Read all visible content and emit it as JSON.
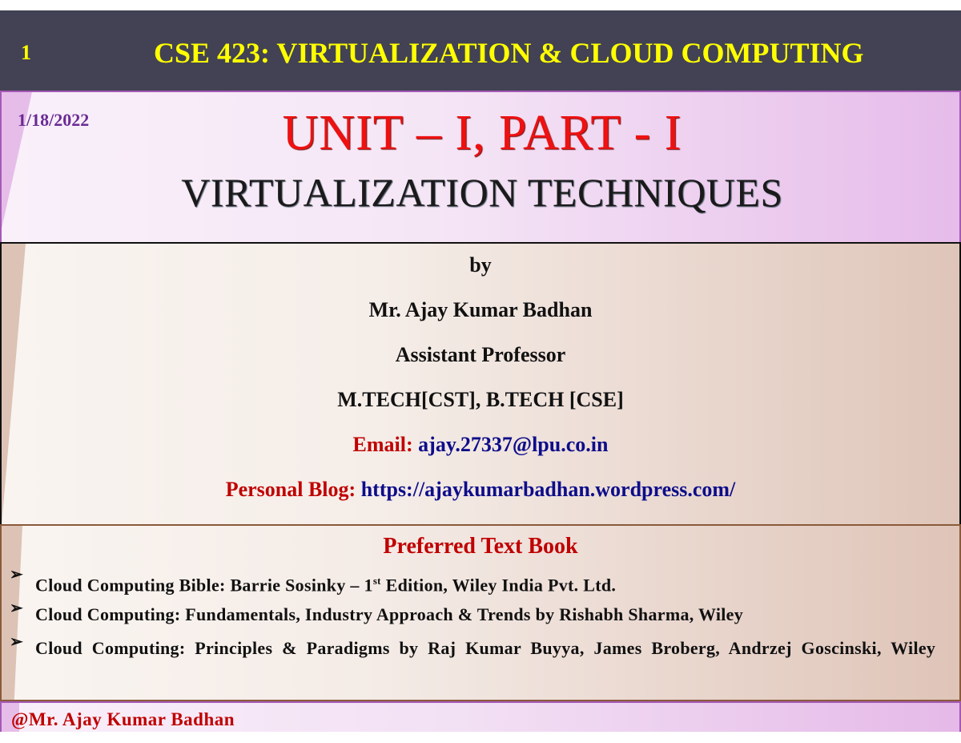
{
  "header": {
    "slide_number": "1",
    "course_title": "CSE 423: VIRTUALIZATION & CLOUD COMPUTING"
  },
  "title_panel": {
    "date": "1/18/2022",
    "unit_title": "UNIT – I, PART - I",
    "topic_title": "VIRTUALIZATION TECHNIQUES"
  },
  "author": {
    "by": "by",
    "name": "Mr. Ajay Kumar Badhan",
    "designation": "Assistant Professor",
    "qualifications": "M.TECH[CST], B.TECH [CSE]",
    "email_label": "Email:",
    "email": "ajay.27337@lpu.co.in",
    "blog_label": "Personal Blog:",
    "blog_url": "https://ajaykumarbadhan.wordpress.com/"
  },
  "textbooks": {
    "heading": "Preferred Text Book",
    "bullet_icon": "➢",
    "items": [
      {
        "before_sup": "Cloud Computing Bible: Barrie Sosinky – 1",
        "sup": "st",
        "after_sup": " Edition, Wiley India Pvt. Ltd."
      },
      {
        "text": "Cloud Computing: Fundamentals, Industry Approach & Trends by Rishabh Sharma, Wiley"
      },
      {
        "text": "Cloud Computing: Principles & Paradigms by Raj Kumar Buyya, James Broberg, Andrzej Goscinski, Wiley"
      }
    ]
  },
  "footer": {
    "text": "@Mr. Ajay Kumar Badhan"
  },
  "colors": {
    "header_bg": "#424254",
    "header_text": "#ffff00",
    "unit_title": "#ee1111",
    "label_red": "#c00000",
    "link_blue": "#0d0d8a",
    "date_purple": "#6a2a94"
  }
}
